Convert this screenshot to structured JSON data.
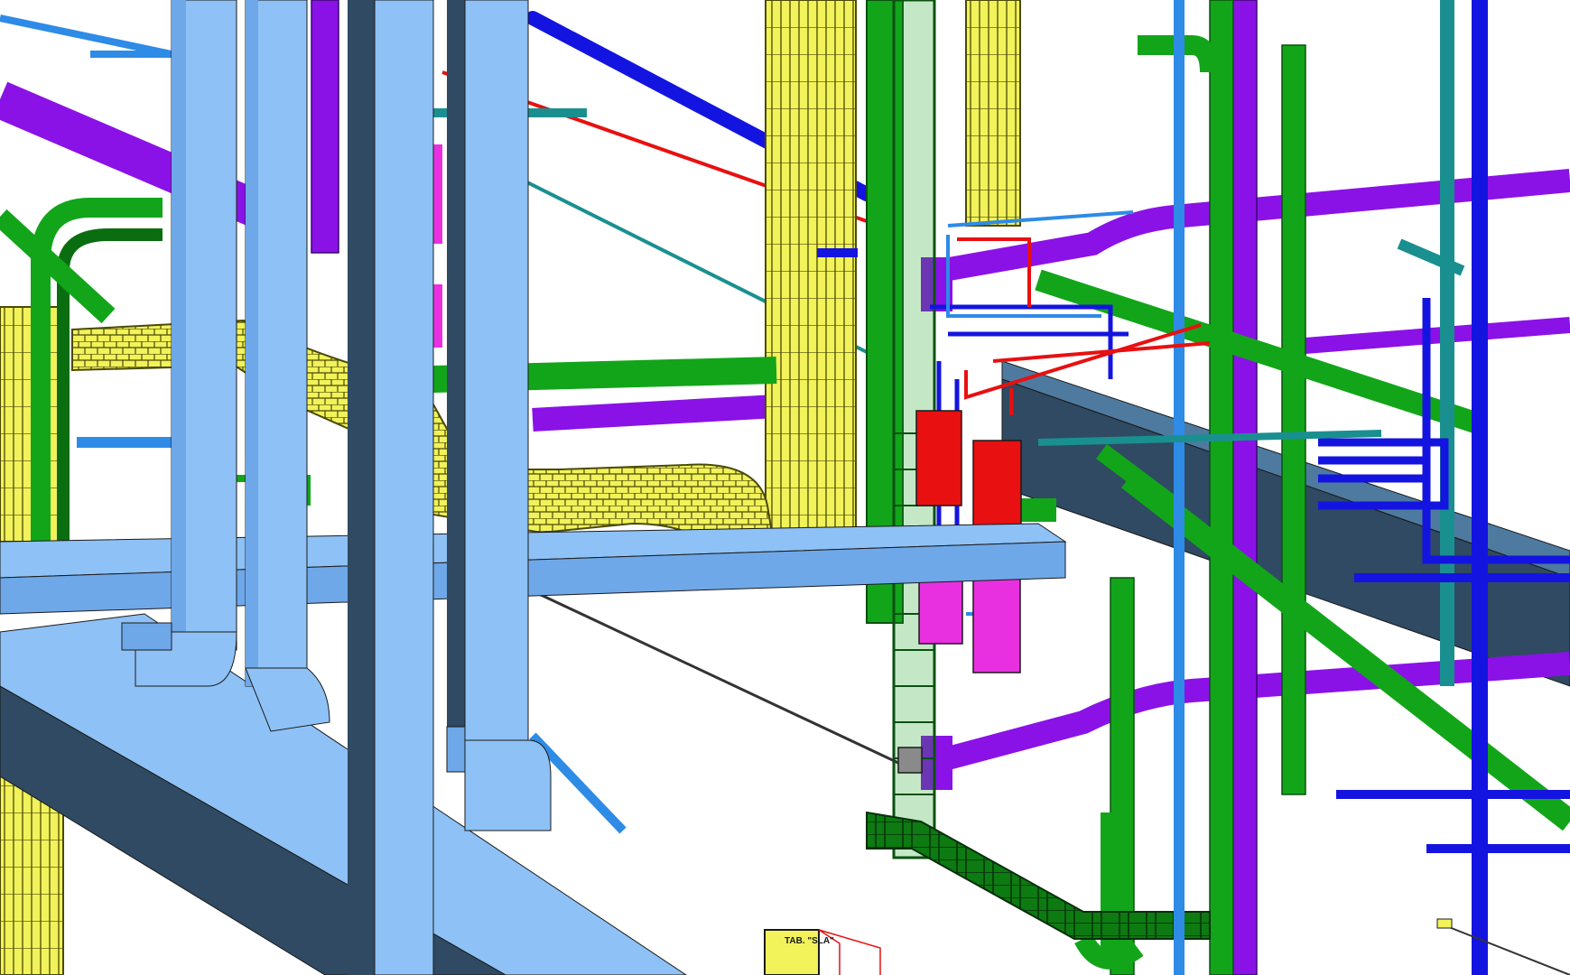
{
  "scene": {
    "colors": {
      "background": "#ffffff",
      "duct_light": "#8ec1f5",
      "duct_mid": "#6fa8e8",
      "duct_dark": "#2f4a62",
      "green_pipe": "#12a51a",
      "green_dark": "#0a6e10",
      "purple_pipe": "#8a12e6",
      "blue_pipe": "#1414e0",
      "light_blue_pipe": "#2e8be6",
      "teal_pipe": "#1a8f90",
      "red_pipe": "#e81010",
      "magenta_box": "#e830e0",
      "yellow_tray": "#f2f25a",
      "yellow_dark": "#8a8a10",
      "outline": "#1a1a1a"
    },
    "icons": {
      "panel": "electrical-panel-icon",
      "valve_box": "junction-box-icon"
    }
  },
  "labels": {
    "panel_label": "TAB. \"SLA\""
  }
}
